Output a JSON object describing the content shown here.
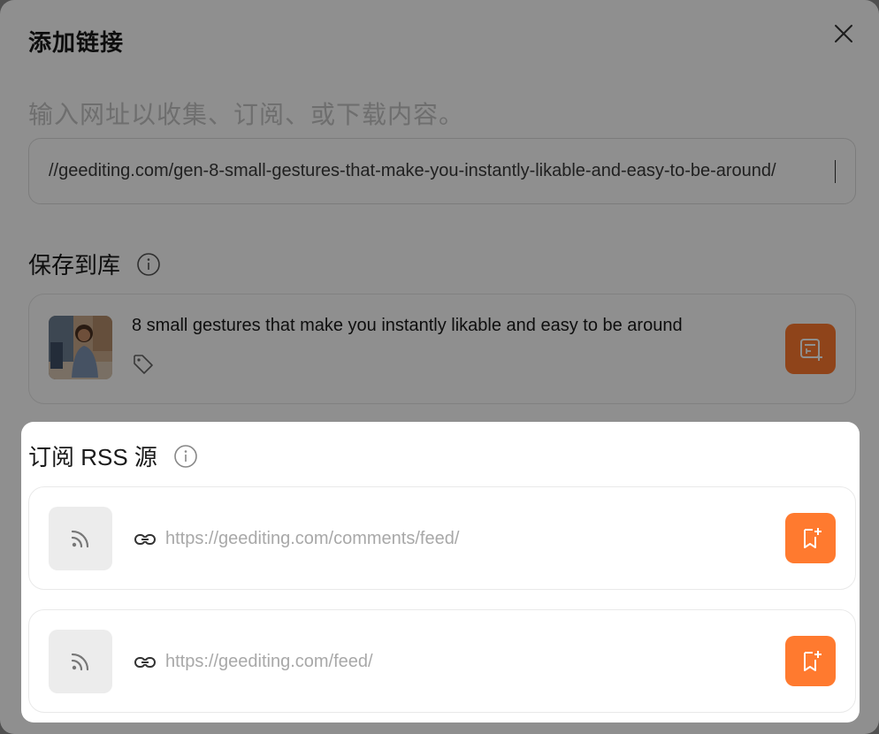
{
  "dialog": {
    "title": "添加链接",
    "hint": "输入网址以收集、订阅、或下载内容。",
    "url_value": "//geediting.com/gen-8-small-gestures-that-make-you-instantly-likable-and-easy-to-be-around/"
  },
  "save_section": {
    "title": "保存到库",
    "article": {
      "title": "8 small gestures that make you instantly likable and easy to be around"
    }
  },
  "rss_section": {
    "title": "订阅 RSS 源",
    "feeds": [
      {
        "url": "https://geediting.com/comments/feed/"
      },
      {
        "url": "https://geediting.com/feed/"
      }
    ]
  },
  "colors": {
    "accent": "#ff7a2f",
    "overlay": "rgba(0,0,0,0.44)"
  }
}
